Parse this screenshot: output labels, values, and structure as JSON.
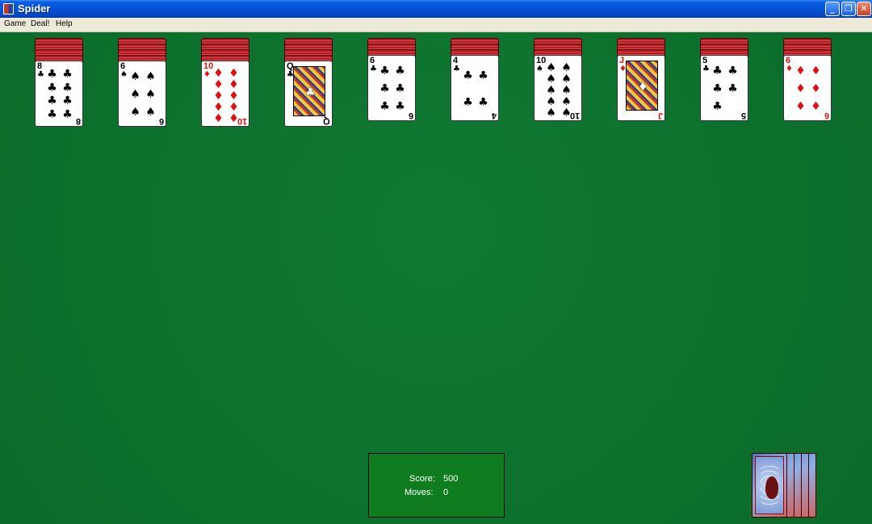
{
  "window": {
    "title": "Spider",
    "minimize": "_",
    "maximize": "❐",
    "close": "✕"
  },
  "menu": {
    "items": [
      "Game",
      "Deal!",
      "Help"
    ]
  },
  "tableau": {
    "piles": [
      {
        "backs": 4,
        "rank": "8",
        "suit": "♣",
        "color": "blk",
        "pips": 8
      },
      {
        "backs": 4,
        "rank": "6",
        "suit": "♠",
        "color": "blk",
        "pips": 6
      },
      {
        "backs": 4,
        "rank": "10",
        "suit": "♦",
        "color": "red",
        "pips": 10
      },
      {
        "backs": 4,
        "rank": "Q",
        "suit": "♣",
        "color": "blk",
        "pips": 0
      },
      {
        "backs": 3,
        "rank": "6",
        "suit": "♣",
        "color": "blk",
        "pips": 6
      },
      {
        "backs": 3,
        "rank": "4",
        "suit": "♣",
        "color": "blk",
        "pips": 4
      },
      {
        "backs": 3,
        "rank": "10",
        "suit": "♠",
        "color": "blk",
        "pips": 10
      },
      {
        "backs": 3,
        "rank": "J",
        "suit": "♦",
        "color": "red",
        "pips": 0
      },
      {
        "backs": 3,
        "rank": "5",
        "suit": "♣",
        "color": "blk",
        "pips": 5
      },
      {
        "backs": 3,
        "rank": "6",
        "suit": "♦",
        "color": "red",
        "pips": 6
      }
    ]
  },
  "status": {
    "score_label": "Score:",
    "score": "500",
    "moves_label": "Moves:",
    "moves": "0"
  },
  "stock": {
    "remaining_deals": 5
  }
}
